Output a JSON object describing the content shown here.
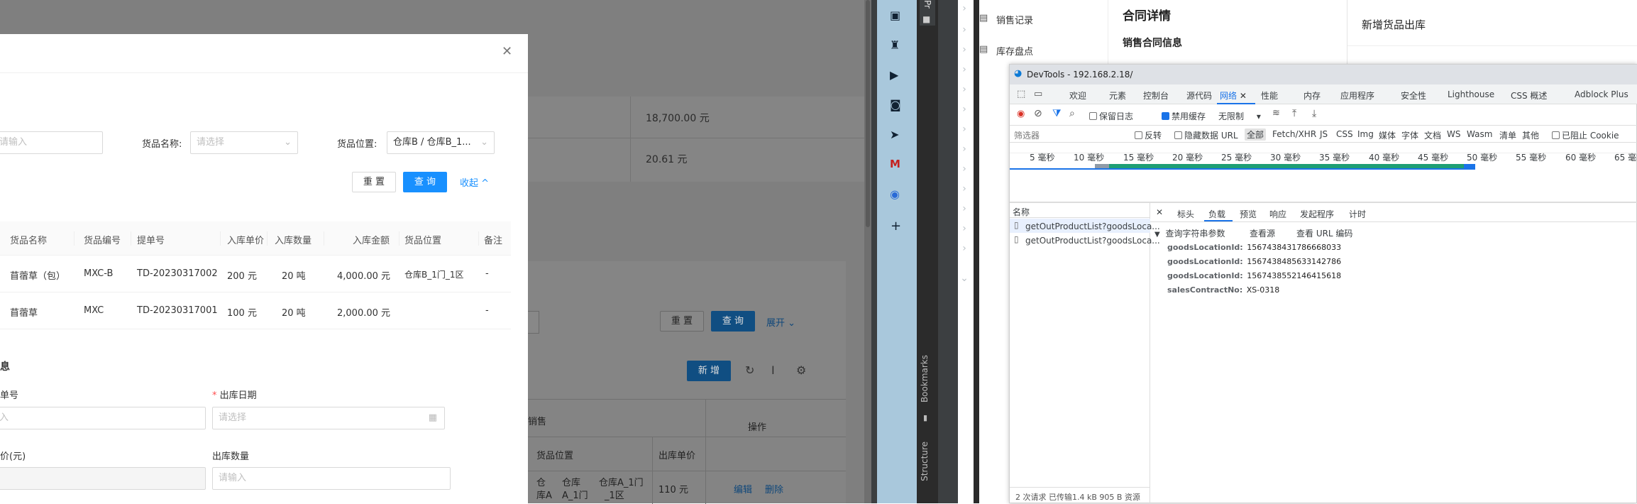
{
  "modal": {
    "goods_name_label": "货品名称:",
    "goods_name_placeholder": "请选择",
    "input_placeholder": "请输入",
    "location_label": "货品位置:",
    "location_value": "仓库B / 仓库B_1...",
    "reset": "重 置",
    "query": "查 询",
    "collapse": "收起",
    "table_headers": [
      "货品名称",
      "货品编号",
      "提单号",
      "入库单价",
      "入库数量",
      "入库金额",
      "货品位置",
      "备注"
    ],
    "rows": [
      [
        "苜蓿草（包）",
        "MXC-B",
        "TD-20230317002",
        "200 元",
        "20 吨",
        "4,000.00 元",
        "仓库B_1门_1区",
        "-"
      ],
      [
        "苜蓿草",
        "MXC",
        "TD-20230317001",
        "100 元",
        "20 吨",
        "2,000.00 元",
        "",
        "-"
      ]
    ],
    "section_fragment": "息",
    "dan_hao_fragment": "单号",
    "date_label": "出库日期",
    "date_placeholder": "请选择",
    "input_fragment": "入",
    "price_fragment": "价(元)",
    "qty_label": "出库数量",
    "qty_placeholder": "请输入"
  },
  "bg": {
    "amount1": "18,700.00 元",
    "amount2": "20.61 元",
    "reset": "重 置",
    "query": "查 询",
    "expand": "展开",
    "add": "新 增",
    "fragment_sale": "销售",
    "headers": [
      "货品位置",
      "出库单价",
      "操作"
    ],
    "loc_cells": [
      "仓",
      "仓库",
      "仓库A_1门",
      "库A",
      "A_1门",
      "_1区"
    ],
    "price": "110 元",
    "edit": "编辑",
    "delete": "删除"
  },
  "ide": {
    "project_frag": "Pr",
    "bookmarks": "Bookmarks",
    "structure": "Structure"
  },
  "contract": {
    "menu": [
      "销售记录",
      "库存盘点"
    ],
    "title": "合同详情",
    "subtitle": "销售合同信息",
    "right_title": "新增货品出库"
  },
  "devtools": {
    "title": "DevTools - 192.168.2.18/",
    "tabs": [
      "欢迎",
      "元素",
      "控制台",
      "源代码",
      "网络",
      "性能",
      "内存",
      "应用程序",
      "安全性",
      "Lighthouse",
      "CSS 概述",
      "Adblock Plus"
    ],
    "preserve_log": "保留日志",
    "disable_cache": "禁用缓存",
    "throttle": "无限制",
    "filter_placeholder": "筛选器",
    "invert": "反转",
    "hide_data_urls": "隐藏数据 URL",
    "types": [
      "全部",
      "Fetch/XHR",
      "JS",
      "CSS",
      "Img",
      "媒体",
      "字体",
      "文档",
      "WS",
      "Wasm",
      "清单",
      "其他"
    ],
    "blocked_cookies": "已阻止 Cookie",
    "ticks": [
      "5 毫秒",
      "10 毫秒",
      "15 毫秒",
      "20 毫秒",
      "25 毫秒",
      "30 毫秒",
      "35 毫秒",
      "40 毫秒",
      "45 毫秒",
      "50 毫秒",
      "55 毫秒",
      "60 毫秒",
      "65 毫秒"
    ],
    "name_header": "名称",
    "requests": [
      "getOutProductList?goodsLoca...",
      "getOutProductList?goodsLoca..."
    ],
    "detail_tabs": [
      "标头",
      "负载",
      "预览",
      "响应",
      "发起程序",
      "计时"
    ],
    "query_params_title": "查询字符串参数",
    "view_source": "查看源",
    "view_url_encoded": "查看 URL 编码",
    "params": [
      {
        "key": "goodsLocationId:",
        "value": "1567438431786668033"
      },
      {
        "key": "goodsLocationId:",
        "value": "1567438485633142786"
      },
      {
        "key": "goodsLocationId:",
        "value": "1567438552146415618"
      },
      {
        "key": "salesContractNo:",
        "value": "XS-0318"
      }
    ],
    "status": "2 次请求  已传输1.4 kB  905 B 资源"
  },
  "colors": {
    "primary": "#1890ff",
    "ide_bg": "#3c3f41",
    "dock": "#a9c8dc",
    "accent": "#1a73e8"
  }
}
